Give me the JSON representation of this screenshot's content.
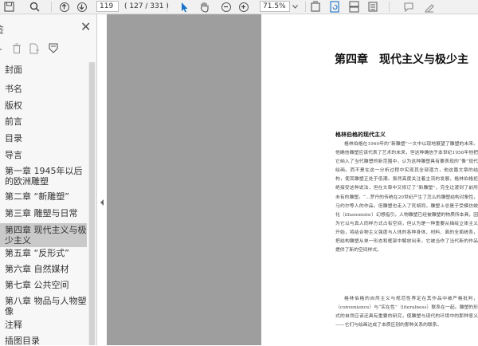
{
  "toolbar": {
    "page_number": "119",
    "page_count": "( 127 / 331 )",
    "zoom": "71.5%"
  },
  "sidebar": {
    "title": "签",
    "items": [
      {
        "label": "封面"
      },
      {
        "label": "书名"
      },
      {
        "label": "版权"
      },
      {
        "label": "前言"
      },
      {
        "label": "目录"
      },
      {
        "label": "导言"
      },
      {
        "label": "第一章 1945年以后的欧洲雕塑"
      },
      {
        "label": "第二章 “新雕塑”"
      },
      {
        "label": "第三章 雕塑与日常"
      },
      {
        "label": "第四章 现代主义与极少主义"
      },
      {
        "label": "第五章 “反形式”"
      },
      {
        "label": "第六章 自然媒材"
      },
      {
        "label": "第七章 公共空间"
      },
      {
        "label": "第八章 物品与人物塑像"
      },
      {
        "label": "注释"
      },
      {
        "label": "插图目录"
      }
    ],
    "selected_index": 9
  },
  "document": {
    "chapter_title": "第四章　现代主义与极少主",
    "section_heading": "格林伯格的现代主义",
    "paragraph_1": "格林伯格在1940年的“新雕塑”一文中以现地展望了雕塑的未来。他确信雕塑应该代表了艺术的未来，但这种确信于本世纪1956年他把它纳入了当代雕塑的新范围中，认为这种雕塑具有要表现的“像”现代绘画。而不是在这一分析过程中实现其全部潜力，他这篇文章的结构，使其雕塑正处于低潮。虽然高度关注着主流的发展，格林伯格拒绝接受这种说法，但在文章中又修订了“新雕塑”，完全过渡到了前所未有的雕塑。“…罗丹的传统在20世纪产生了怎么的雕塑结构对象性，马约尔等人的作品。但雕塑也走入了死胡同，雕塑上总是于受模仿蜕化（illusionistic）幻想指引，人物雕塑已经被雕塑的物质所本具，因为它以与真人同样方式占有空间，但认为是一种重要从描绘立体主义开始，将结合物主义强度与人体的各种身体、材料、面的全面统系，把结构雕塑从单一形态和框架中解放出来，它被当作了当代新的作品提供了新的空间样式。",
    "paragraph_2": "格林伯格的自然主义与规范性界定在其作品中被严格批判，（convenience）与“实在性”（literalness）联系在一起。雕塑的形式的自然应该还具有重要的研究，使雕塑与现代的环境中的那种意义——它们与绘画达成了本质区别的那种关系的联系。"
  }
}
